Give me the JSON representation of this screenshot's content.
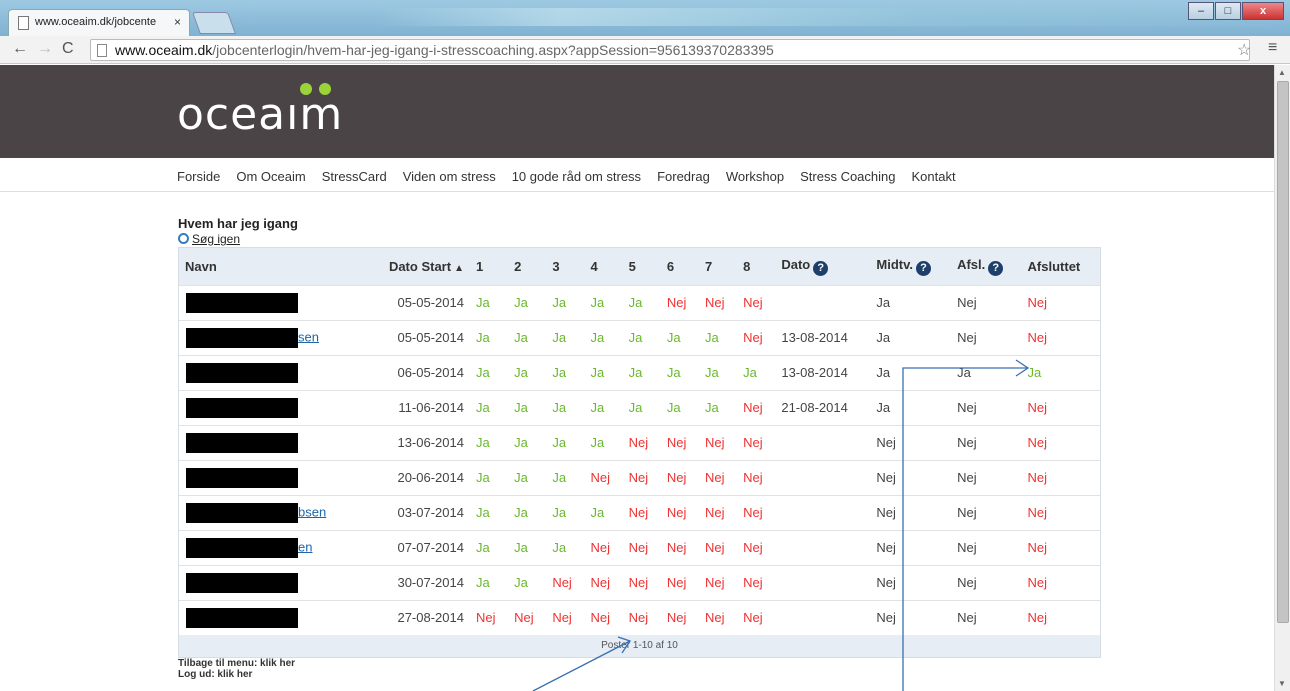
{
  "browser": {
    "tab_title": "www.oceaim.dk/jobcente",
    "tab_close": "×",
    "url_host": "www.oceaim.dk",
    "url_path": "/jobcenterlogin/hvem-har-jeg-igang-i-stresscoaching.aspx?appSession=956139370283395",
    "win_min": "‒",
    "win_max": "□",
    "win_close": "x"
  },
  "site": {
    "logo": "oceaım",
    "nav": [
      "Forside",
      "Om Oceaim",
      "StressCard",
      "Viden om stress",
      "10 gode råd om stress",
      "Foredrag",
      "Workshop",
      "Stress Coaching",
      "Kontakt"
    ]
  },
  "page": {
    "heading": "Hvem har jeg igang",
    "search_again": "Søg igen",
    "table": {
      "headers": [
        "Navn",
        "Dato Start",
        "1",
        "2",
        "3",
        "4",
        "5",
        "6",
        "7",
        "8",
        "Dato",
        "Midtv.",
        "Afsl.",
        "Afsluttet"
      ],
      "rows": [
        {
          "name_suffix": "",
          "start": "05-05-2014",
          "weeks": [
            "Ja",
            "Ja",
            "Ja",
            "Ja",
            "Ja",
            "Nej",
            "Nej",
            "Nej"
          ],
          "dato": "",
          "midtv": "Ja",
          "afsl": "Nej",
          "afsluttet": "Nej"
        },
        {
          "name_suffix": "sen",
          "start": "05-05-2014",
          "weeks": [
            "Ja",
            "Ja",
            "Ja",
            "Ja",
            "Ja",
            "Ja",
            "Ja",
            "Nej"
          ],
          "dato": "13-08-2014",
          "midtv": "Ja",
          "afsl": "Nej",
          "afsluttet": "Nej"
        },
        {
          "name_suffix": "",
          "start": "06-05-2014",
          "weeks": [
            "Ja",
            "Ja",
            "Ja",
            "Ja",
            "Ja",
            "Ja",
            "Ja",
            "Ja"
          ],
          "dato": "13-08-2014",
          "midtv": "Ja",
          "afsl": "Ja",
          "afsluttet": "Ja"
        },
        {
          "name_suffix": "",
          "start": "11-06-2014",
          "weeks": [
            "Ja",
            "Ja",
            "Ja",
            "Ja",
            "Ja",
            "Ja",
            "Ja",
            "Nej"
          ],
          "dato": "21-08-2014",
          "midtv": "Ja",
          "afsl": "Nej",
          "afsluttet": "Nej"
        },
        {
          "name_suffix": "",
          "start": "13-06-2014",
          "weeks": [
            "Ja",
            "Ja",
            "Ja",
            "Ja",
            "Nej",
            "Nej",
            "Nej",
            "Nej"
          ],
          "dato": "",
          "midtv": "Nej",
          "afsl": "Nej",
          "afsluttet": "Nej"
        },
        {
          "name_suffix": "",
          "start": "20-06-2014",
          "weeks": [
            "Ja",
            "Ja",
            "Ja",
            "Nej",
            "Nej",
            "Nej",
            "Nej",
            "Nej"
          ],
          "dato": "",
          "midtv": "Nej",
          "afsl": "Nej",
          "afsluttet": "Nej"
        },
        {
          "name_suffix": "bsen",
          "start": "03-07-2014",
          "weeks": [
            "Ja",
            "Ja",
            "Ja",
            "Ja",
            "Nej",
            "Nej",
            "Nej",
            "Nej"
          ],
          "dato": "",
          "midtv": "Nej",
          "afsl": "Nej",
          "afsluttet": "Nej"
        },
        {
          "name_suffix": "en",
          "start": "07-07-2014",
          "weeks": [
            "Ja",
            "Ja",
            "Ja",
            "Nej",
            "Nej",
            "Nej",
            "Nej",
            "Nej"
          ],
          "dato": "",
          "midtv": "Nej",
          "afsl": "Nej",
          "afsluttet": "Nej"
        },
        {
          "name_suffix": "",
          "start": "30-07-2014",
          "weeks": [
            "Ja",
            "Ja",
            "Nej",
            "Nej",
            "Nej",
            "Nej",
            "Nej",
            "Nej"
          ],
          "dato": "",
          "midtv": "Nej",
          "afsl": "Nej",
          "afsluttet": "Nej"
        },
        {
          "name_suffix": "",
          "start": "27-08-2014",
          "weeks": [
            "Nej",
            "Nej",
            "Nej",
            "Nej",
            "Nej",
            "Nej",
            "Nej",
            "Nej"
          ],
          "dato": "",
          "midtv": "Nej",
          "afsl": "Nej",
          "afsluttet": "Nej"
        }
      ],
      "pager": "Poster 1-10 af 10"
    },
    "back_link": "Tilbage til menu: klik her",
    "logout_link": "Log ud: klik her"
  },
  "colors": {
    "ja": "#6ab82e",
    "nej": "#ee3333",
    "header_band": "#4b4447",
    "logo_dots": "#9dd33a",
    "annotation_arrows": "#3a6fb0"
  }
}
